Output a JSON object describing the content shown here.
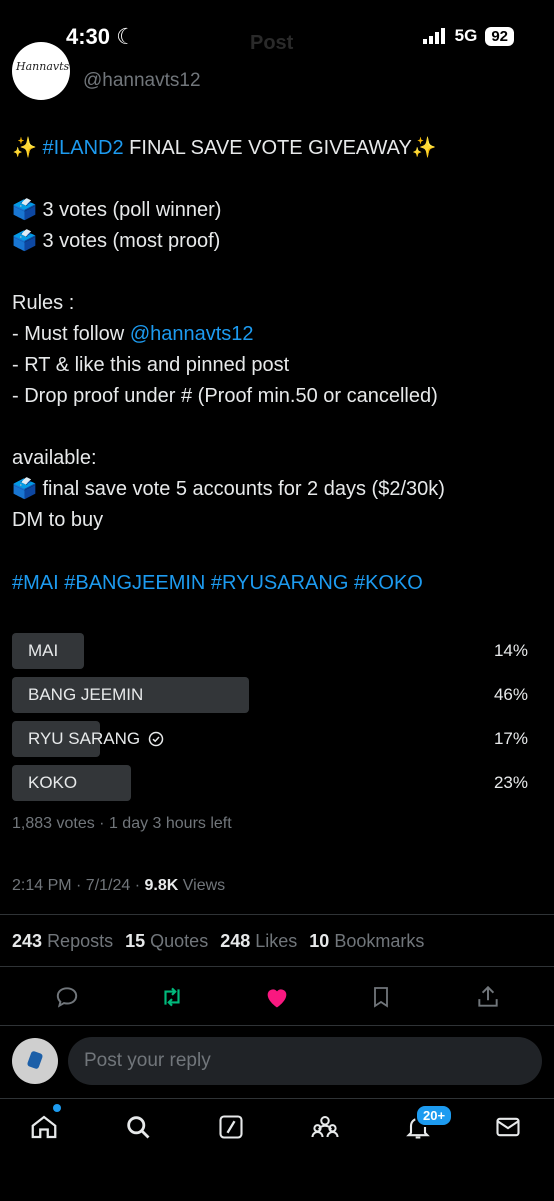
{
  "status_bar": {
    "time": "4:30",
    "network": "5G",
    "battery": "92"
  },
  "header": {
    "title": "Post"
  },
  "author": {
    "handle": "@hannavts12",
    "avatar_text": "Hannavts"
  },
  "tweet": {
    "line1_prefix": "✨ ",
    "line1_hashtag": "#ILAND2",
    "line1_text": " FINAL SAVE VOTE GIVEAWAY✨",
    "vote1": "🗳️ 3 votes (poll winner)",
    "vote2": "🗳️ 3 votes (most proof)",
    "rules_title": "Rules :",
    "rule1_prefix": "- Must follow ",
    "rule1_handle": "@hannavts12",
    "rule2": "- RT & like this and pinned post",
    "rule3": "- Drop proof under # (Proof min.50 or cancelled)",
    "available_title": "available:",
    "available_item": "🗳️ final save vote 5 accounts for 2 days ($2/30k)",
    "dm_text": "DM to buy",
    "hashtags": "#MAI #BANGJEEMIN #RYUSARANG #KOKO"
  },
  "poll": {
    "options": [
      {
        "label": "MAI",
        "percent": "14%",
        "value": 14,
        "selected": false
      },
      {
        "label": "BANG JEEMIN",
        "percent": "46%",
        "value": 46,
        "selected": false
      },
      {
        "label": "RYU SARANG",
        "percent": "17%",
        "value": 17,
        "selected": true
      },
      {
        "label": "KOKO",
        "percent": "23%",
        "value": 23,
        "selected": false
      }
    ],
    "meta": "1,883 votes · 1 day 3 hours left"
  },
  "timestamp": {
    "time": "2:14 PM · 7/1/24 · ",
    "views_count": "9.8K",
    "views_label": " Views"
  },
  "stats": {
    "reposts_count": "243",
    "reposts_label": "Reposts",
    "quotes_count": "15",
    "quotes_label": "Quotes",
    "likes_count": "248",
    "likes_label": "Likes",
    "bookmarks_count": "10",
    "bookmarks_label": "Bookmarks"
  },
  "reply": {
    "placeholder": "Post your reply"
  },
  "nav": {
    "notifications_badge": "20+"
  },
  "colors": {
    "accent": "#1d9bf0",
    "like": "#f91880",
    "repost": "#00ba7c",
    "poll_bar": "#333639",
    "muted": "#71767b"
  }
}
